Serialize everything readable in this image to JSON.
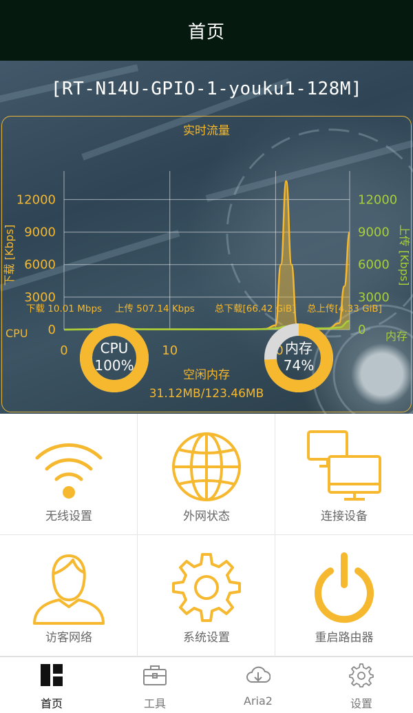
{
  "header": {
    "title": "首页"
  },
  "device": {
    "name": "[RT-N14U-GPIO-1-youku1-128M]"
  },
  "traffic": {
    "chart_title": "实时流量",
    "download_axis_label": "下载 [Kbps]",
    "upload_axis_label": "上传 [Kbps]",
    "download_stat": "下载 10.01 Mbps",
    "upload_stat": "上传 507.14 Kbps",
    "total_download": "总下载[66.42 GiB]",
    "total_upload": "总上传[4.33 GiB]"
  },
  "chart_data": {
    "type": "line",
    "title": "实时流量",
    "ylabel_left": "下载 [Kbps]",
    "ylabel_right": "上传 [Kbps]",
    "xlim": [
      0,
      27
    ],
    "ylim": [
      0,
      14000
    ],
    "x_ticks": [
      "0",
      "10",
      "20"
    ],
    "y_ticks_left": [
      "0",
      "3000",
      "6000",
      "9000",
      "12000"
    ],
    "y_ticks_right": [
      "0",
      "3000",
      "6000",
      "9000",
      "12000"
    ],
    "grid": true,
    "series": [
      {
        "name": "下载",
        "color": "#f5b82e",
        "x": [
          0,
          2,
          4,
          5,
          6,
          7,
          9,
          12,
          15,
          18,
          19,
          20,
          20.5,
          21,
          21.5,
          22,
          23,
          24,
          25,
          26,
          26.5,
          27
        ],
        "y": [
          0,
          30,
          120,
          250,
          120,
          30,
          20,
          20,
          20,
          30,
          60,
          400,
          6000,
          13700,
          6000,
          500,
          60,
          40,
          120,
          600,
          4000,
          9000
        ]
      },
      {
        "name": "上传",
        "color": "#a8cf38",
        "x": [
          0,
          3,
          6,
          10,
          15,
          19,
          20,
          21,
          22,
          23,
          25,
          26,
          27
        ],
        "y": [
          0,
          20,
          40,
          30,
          30,
          40,
          120,
          300,
          250,
          120,
          120,
          200,
          800
        ]
      }
    ]
  },
  "cpu": {
    "label": "CPU",
    "gauge_title": "CPU",
    "gauge_value": "100%",
    "usage": 1.0
  },
  "memory": {
    "label": "内存",
    "gauge_title": "内存",
    "gauge_value": "74%",
    "usage": 0.74,
    "free_label": "空闲内存",
    "free_value": "31.12MB/123.46MB"
  },
  "colors": {
    "accent": "#f5b82e",
    "upload_green": "#a8cf38",
    "header_bg": "#05190e"
  },
  "tiles": [
    {
      "label": "无线设置",
      "icon": "wifi-icon"
    },
    {
      "label": "外网状态",
      "icon": "globe-icon"
    },
    {
      "label": "连接设备",
      "icon": "devices-icon"
    },
    {
      "label": "访客网络",
      "icon": "guest-user-icon"
    },
    {
      "label": "系统设置",
      "icon": "gear-icon"
    },
    {
      "label": "重启路由器",
      "icon": "power-icon"
    }
  ],
  "nav": [
    {
      "label": "首页",
      "icon": "dashboard-icon",
      "active": true
    },
    {
      "label": "工具",
      "icon": "toolbox-icon",
      "active": false
    },
    {
      "label": "Aria2",
      "icon": "cloud-download-icon",
      "active": false
    },
    {
      "label": "设置",
      "icon": "settings-icon",
      "active": false
    }
  ]
}
